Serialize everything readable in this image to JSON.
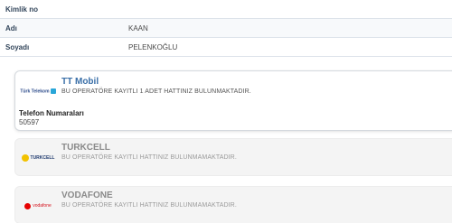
{
  "info": {
    "kimlik_label": "Kimlik no",
    "kimlik_value": "",
    "adi_label": "Adı",
    "adi_value": "KAAN",
    "soyadi_label": "Soyadı",
    "soyadi_value": "PELENKOĞLU"
  },
  "operators": [
    {
      "name": "TT Mobil",
      "message": "BU OPERATÖRE KAYITLI 1 ADET HATTINIZ BULUNMAKTADIR.",
      "logo_text": "Türk Telekom",
      "logo_icon": "turk-telekom-logo",
      "phone_title": "Telefon Numaraları",
      "phone_value": "50597"
    },
    {
      "name": "TURKCELL",
      "message": "BU OPERATÖRE KAYITLI HATTINIZ BULUNMAMAKTADIR.",
      "logo_text": "TURKCELL",
      "logo_icon": "turkcell-logo"
    },
    {
      "name": "VODAFONE",
      "message": "BU OPERATÖRE KAYITLI HATTINIZ BULUNMAMAKTADIR.",
      "logo_text": "vodafone",
      "logo_icon": "vodafone-logo"
    }
  ],
  "colors": {
    "accent": "#3a6fa8",
    "muted": "#8a8a8a",
    "label": "#34475c"
  }
}
